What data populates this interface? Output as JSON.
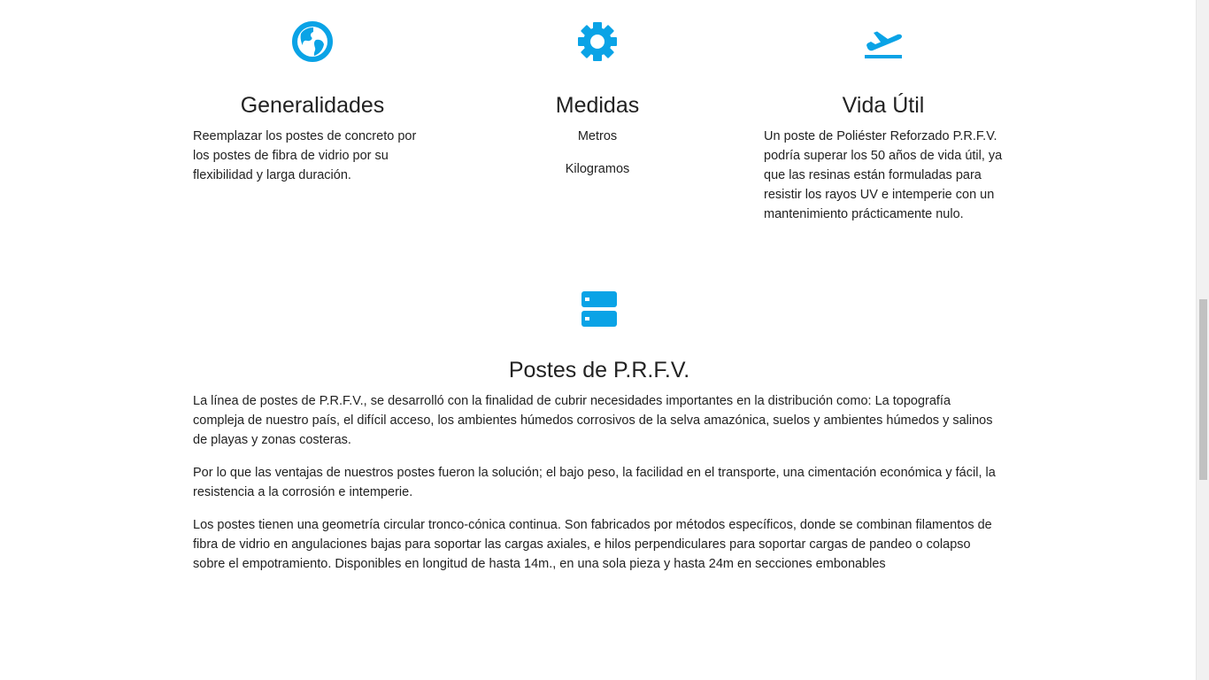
{
  "accent_color": "#0aa3e6",
  "features": [
    {
      "icon": "globe-icon",
      "title": "Generalidades",
      "text": "Reemplazar los postes de concreto por los postes de fibra de vidrio por su flexibilidad y larga duración."
    },
    {
      "icon": "gear-icon",
      "title": "Medidas",
      "items": [
        "Metros",
        "Kilogramos"
      ]
    },
    {
      "icon": "airplane-takeoff-icon",
      "title": "Vida Útil",
      "text": "Un poste de Poliéster Reforzado P.R.F.V. podría superar los 50 años de vida útil, ya que las resinas están formuladas para resistir los rayos UV e intemperie con un mantenimiento prácticamente nulo."
    }
  ],
  "section": {
    "icon": "server-icon",
    "title": "Postes de P.R.F.V.",
    "paragraphs": [
      "La línea de postes de P.R.F.V., se desarrolló con la finalidad de cubrir necesidades importantes en la distribución como: La topografía compleja de nuestro país, el difícil acceso, los ambientes húmedos corrosivos de la selva amazónica, suelos y ambientes húmedos y salinos de playas y zonas costeras.",
      "Por lo que las ventajas de nuestros postes fueron la solución; el bajo peso, la facilidad en el transporte, una cimentación económica y fácil, la resistencia a la corrosión e intemperie.",
      "Los postes tienen una geometría circular tronco-cónica continua. Son fabricados por métodos específicos, donde se combinan filamentos de fibra de vidrio en angulaciones bajas para soportar las cargas axiales, e hilos perpendiculares para soportar cargas de pandeo o colapso sobre el empotramiento. Disponibles en longitud de hasta 14m., en una sola pieza y hasta 24m en secciones embonables"
    ]
  }
}
